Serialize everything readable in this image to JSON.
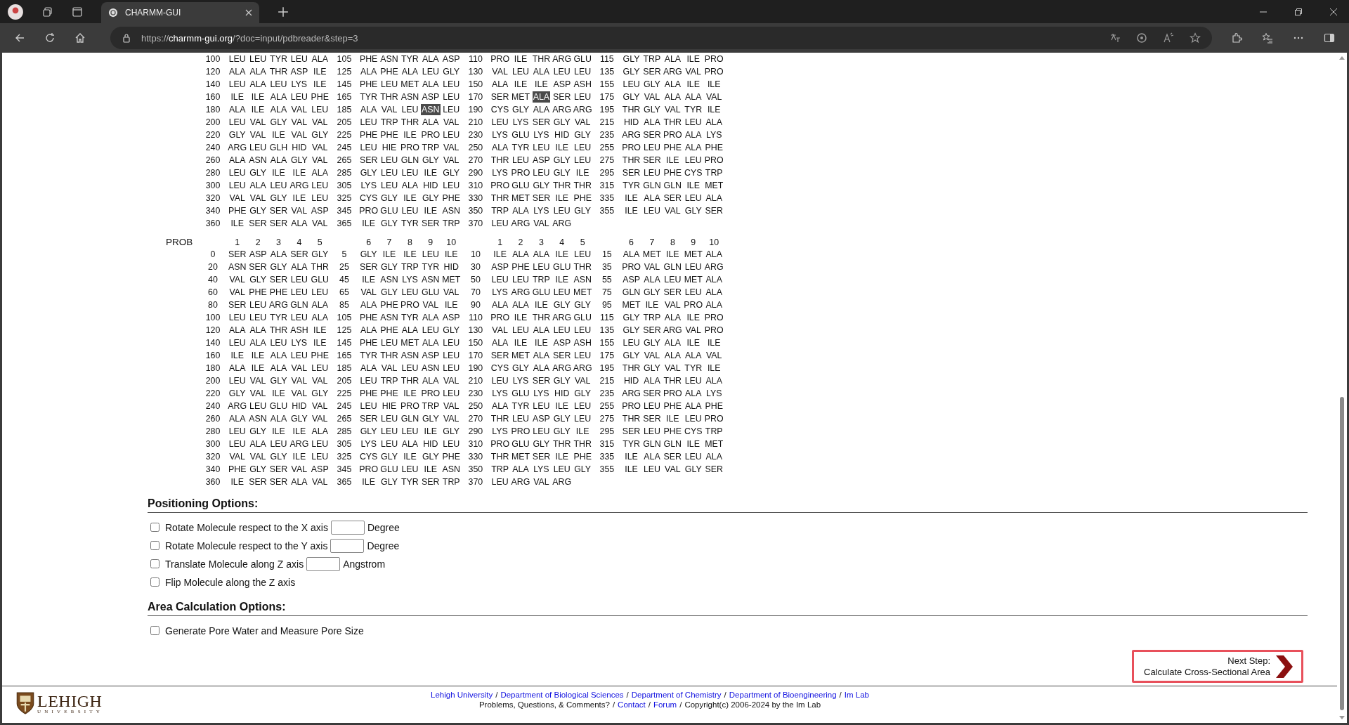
{
  "browser": {
    "tab_title": "CHARMM-GUI",
    "url": "https://**charmm-gui.org**/?doc=input/pdbreader&step=3"
  },
  "sequence_blocks": [
    {
      "rows": [
        [
          {
            "number": "100",
            "residues": [
              "LEU",
              "LEU",
              "TYR",
              "LEU",
              "ALA"
            ]
          },
          {
            "number": "105",
            "residues": [
              "PHE",
              "ASN",
              "TYR",
              "ALA",
              "ASP"
            ]
          },
          {
            "number": "110",
            "residues": [
              "PRO",
              "ILE",
              "THR",
              "ARG",
              "GLU"
            ]
          },
          {
            "number": "115",
            "residues": [
              "GLY",
              "TRP",
              "ALA",
              "ILE",
              "PRO"
            ]
          }
        ],
        [
          {
            "number": "120",
            "residues": [
              "ALA",
              "ALA",
              "THR",
              "ASP",
              "ILE"
            ]
          },
          {
            "number": "125",
            "residues": [
              "ALA",
              "PHE",
              "ALA",
              "LEU",
              "GLY"
            ]
          },
          {
            "number": "130",
            "residues": [
              "VAL",
              "LEU",
              "ALA",
              "LEU",
              "LEU"
            ]
          },
          {
            "number": "135",
            "residues": [
              "GLY",
              "SER",
              "ARG",
              "VAL",
              "PRO"
            ]
          }
        ],
        [
          {
            "number": "140",
            "residues": [
              "LEU",
              "ALA",
              "LEU",
              "LYS",
              "ILE"
            ]
          },
          {
            "number": "145",
            "residues": [
              "PHE",
              "LEU",
              "MET",
              "ALA",
              "LEU"
            ]
          },
          {
            "number": "150",
            "residues": [
              "ALA",
              "ILE",
              "ILE",
              "ASP",
              "ASH"
            ]
          },
          {
            "number": "155",
            "residues": [
              "LEU",
              "GLY",
              "ALA",
              "ILE",
              "ILE"
            ]
          }
        ],
        [
          {
            "number": "160",
            "residues": [
              "ILE",
              "ILE",
              "ALA",
              "LEU",
              "PHE"
            ]
          },
          {
            "number": "165",
            "residues": [
              "TYR",
              "THR",
              "ASN",
              "ASP",
              "LEU"
            ]
          },
          {
            "number": "170",
            "residues": [
              "SER",
              "MET",
              {
                "name": "ALA",
                "selected": true
              },
              "SER",
              "LEU"
            ]
          },
          {
            "number": "175",
            "residues": [
              "GLY",
              "VAL",
              "ALA",
              "ALA",
              "VAL"
            ]
          }
        ],
        [
          {
            "number": "180",
            "residues": [
              "ALA",
              "ILE",
              "ALA",
              "VAL",
              "LEU"
            ]
          },
          {
            "number": "185",
            "residues": [
              "ALA",
              "VAL",
              "LEU",
              {
                "name": "ASN",
                "selected": true
              },
              "LEU"
            ]
          },
          {
            "number": "190",
            "residues": [
              "CYS",
              "GLY",
              "ALA",
              "ARG",
              "ARG"
            ]
          },
          {
            "number": "195",
            "residues": [
              "THR",
              "GLY",
              "VAL",
              "TYR",
              "ILE"
            ]
          }
        ],
        [
          {
            "number": "200",
            "residues": [
              "LEU",
              "VAL",
              "GLY",
              "VAL",
              "VAL"
            ]
          },
          {
            "number": "205",
            "residues": [
              "LEU",
              "TRP",
              "THR",
              "ALA",
              "VAL"
            ]
          },
          {
            "number": "210",
            "residues": [
              "LEU",
              "LYS",
              "SER",
              "GLY",
              "VAL"
            ]
          },
          {
            "number": "215",
            "residues": [
              "HID",
              "ALA",
              "THR",
              "LEU",
              "ALA"
            ]
          }
        ],
        [
          {
            "number": "220",
            "residues": [
              "GLY",
              "VAL",
              "ILE",
              "VAL",
              "GLY"
            ]
          },
          {
            "number": "225",
            "residues": [
              "PHE",
              "PHE",
              "ILE",
              "PRO",
              "LEU"
            ]
          },
          {
            "number": "230",
            "residues": [
              "LYS",
              "GLU",
              "LYS",
              "HID",
              "GLY"
            ]
          },
          {
            "number": "235",
            "residues": [
              "ARG",
              "SER",
              "PRO",
              "ALA",
              "LYS"
            ]
          }
        ],
        [
          {
            "number": "240",
            "residues": [
              "ARG",
              "LEU",
              "GLH",
              "HID",
              "VAL"
            ]
          },
          {
            "number": "245",
            "residues": [
              "LEU",
              "HIE",
              "PRO",
              "TRP",
              "VAL"
            ]
          },
          {
            "number": "250",
            "residues": [
              "ALA",
              "TYR",
              "LEU",
              "ILE",
              "LEU"
            ]
          },
          {
            "number": "255",
            "residues": [
              "PRO",
              "LEU",
              "PHE",
              "ALA",
              "PHE"
            ]
          }
        ],
        [
          {
            "number": "260",
            "residues": [
              "ALA",
              "ASN",
              "ALA",
              "GLY",
              "VAL"
            ]
          },
          {
            "number": "265",
            "residues": [
              "SER",
              "LEU",
              "GLN",
              "GLY",
              "VAL"
            ]
          },
          {
            "number": "270",
            "residues": [
              "THR",
              "LEU",
              "ASP",
              "GLY",
              "LEU"
            ]
          },
          {
            "number": "275",
            "residues": [
              "THR",
              "SER",
              "ILE",
              "LEU",
              "PRO"
            ]
          }
        ],
        [
          {
            "number": "280",
            "residues": [
              "LEU",
              "GLY",
              "ILE",
              "ILE",
              "ALA"
            ]
          },
          {
            "number": "285",
            "residues": [
              "GLY",
              "LEU",
              "LEU",
              "ILE",
              "GLY"
            ]
          },
          {
            "number": "290",
            "residues": [
              "LYS",
              "PRO",
              "LEU",
              "GLY",
              "ILE"
            ]
          },
          {
            "number": "295",
            "residues": [
              "SER",
              "LEU",
              "PHE",
              "CYS",
              "TRP"
            ]
          }
        ],
        [
          {
            "number": "300",
            "residues": [
              "LEU",
              "ALA",
              "LEU",
              "ARG",
              "LEU"
            ]
          },
          {
            "number": "305",
            "residues": [
              "LYS",
              "LEU",
              "ALA",
              "HID",
              "LEU"
            ]
          },
          {
            "number": "310",
            "residues": [
              "PRO",
              "GLU",
              "GLY",
              "THR",
              "THR"
            ]
          },
          {
            "number": "315",
            "residues": [
              "TYR",
              "GLN",
              "GLN",
              "ILE",
              "MET"
            ]
          }
        ],
        [
          {
            "number": "320",
            "residues": [
              "VAL",
              "VAL",
              "GLY",
              "ILE",
              "LEU"
            ]
          },
          {
            "number": "325",
            "residues": [
              "CYS",
              "GLY",
              "ILE",
              "GLY",
              "PHE"
            ]
          },
          {
            "number": "330",
            "residues": [
              "THR",
              "MET",
              "SER",
              "ILE",
              "PHE"
            ]
          },
          {
            "number": "335",
            "residues": [
              "ILE",
              "ALA",
              "SER",
              "LEU",
              "ALA"
            ]
          }
        ],
        [
          {
            "number": "340",
            "residues": [
              "PHE",
              "GLY",
              "SER",
              "VAL",
              "ASP"
            ]
          },
          {
            "number": "345",
            "residues": [
              "PRO",
              "GLU",
              "LEU",
              "ILE",
              "ASN"
            ]
          },
          {
            "number": "350",
            "residues": [
              "TRP",
              "ALA",
              "LYS",
              "LEU",
              "GLY"
            ]
          },
          {
            "number": "355",
            "residues": [
              "ILE",
              "LEU",
              "VAL",
              "GLY",
              "SER"
            ]
          }
        ],
        [
          {
            "number": "360",
            "residues": [
              "ILE",
              "SER",
              "SER",
              "ALA",
              "VAL"
            ]
          },
          {
            "number": "365",
            "residues": [
              "ILE",
              "GLY",
              "TYR",
              "SER",
              "TRP"
            ]
          },
          {
            "number": "370",
            "residues": [
              "LEU",
              "ARG",
              "VAL",
              "ARG"
            ]
          }
        ]
      ]
    },
    {
      "label": "PROB",
      "column_numbers": [
        "1",
        "2",
        "3",
        "4",
        "5",
        "6",
        "7",
        "8",
        "9",
        "10",
        "1",
        "2",
        "3",
        "4",
        "5",
        "6",
        "7",
        "8",
        "9",
        "10"
      ],
      "rows": [
        [
          {
            "number": "0",
            "residues": [
              "SER",
              "ASP",
              "ALA",
              "SER",
              "GLY"
            ]
          },
          {
            "number": "5",
            "residues": [
              "GLY",
              "ILE",
              "ILE",
              "LEU",
              "ILE"
            ]
          },
          {
            "number": "10",
            "residues": [
              "ILE",
              "ALA",
              "ALA",
              "ILE",
              "LEU"
            ]
          },
          {
            "number": "15",
            "residues": [
              "ALA",
              "MET",
              "ILE",
              "MET",
              "ALA"
            ]
          }
        ],
        [
          {
            "number": "20",
            "residues": [
              "ASN",
              "SER",
              "GLY",
              "ALA",
              "THR"
            ]
          },
          {
            "number": "25",
            "residues": [
              "SER",
              "GLY",
              "TRP",
              "TYR",
              "HID"
            ]
          },
          {
            "number": "30",
            "residues": [
              "ASP",
              "PHE",
              "LEU",
              "GLU",
              "THR"
            ]
          },
          {
            "number": "35",
            "residues": [
              "PRO",
              "VAL",
              "GLN",
              "LEU",
              "ARG"
            ]
          }
        ],
        [
          {
            "number": "40",
            "residues": [
              "VAL",
              "GLY",
              "SER",
              "LEU",
              "GLU"
            ]
          },
          {
            "number": "45",
            "residues": [
              "ILE",
              "ASN",
              "LYS",
              "ASN",
              "MET"
            ]
          },
          {
            "number": "50",
            "residues": [
              "LEU",
              "LEU",
              "TRP",
              "ILE",
              "ASN"
            ]
          },
          {
            "number": "55",
            "residues": [
              "ASP",
              "ALA",
              "LEU",
              "MET",
              "ALA"
            ]
          }
        ],
        [
          {
            "number": "60",
            "residues": [
              "VAL",
              "PHE",
              "PHE",
              "LEU",
              "LEU"
            ]
          },
          {
            "number": "65",
            "residues": [
              "VAL",
              "GLY",
              "LEU",
              "GLU",
              "VAL"
            ]
          },
          {
            "number": "70",
            "residues": [
              "LYS",
              "ARG",
              "GLU",
              "LEU",
              "MET"
            ]
          },
          {
            "number": "75",
            "residues": [
              "GLN",
              "GLY",
              "SER",
              "LEU",
              "ALA"
            ]
          }
        ],
        [
          {
            "number": "80",
            "residues": [
              "SER",
              "LEU",
              "ARG",
              "GLN",
              "ALA"
            ]
          },
          {
            "number": "85",
            "residues": [
              "ALA",
              "PHE",
              "PRO",
              "VAL",
              "ILE"
            ]
          },
          {
            "number": "90",
            "residues": [
              "ALA",
              "ALA",
              "ILE",
              "GLY",
              "GLY"
            ]
          },
          {
            "number": "95",
            "residues": [
              "MET",
              "ILE",
              "VAL",
              "PRO",
              "ALA"
            ]
          }
        ],
        [
          {
            "number": "100",
            "residues": [
              "LEU",
              "LEU",
              "TYR",
              "LEU",
              "ALA"
            ]
          },
          {
            "number": "105",
            "residues": [
              "PHE",
              "ASN",
              "TYR",
              "ALA",
              "ASP"
            ]
          },
          {
            "number": "110",
            "residues": [
              "PRO",
              "ILE",
              "THR",
              "ARG",
              "GLU"
            ]
          },
          {
            "number": "115",
            "residues": [
              "GLY",
              "TRP",
              "ALA",
              "ILE",
              "PRO"
            ]
          }
        ],
        [
          {
            "number": "120",
            "residues": [
              "ALA",
              "ALA",
              "THR",
              "ASH",
              "ILE"
            ]
          },
          {
            "number": "125",
            "residues": [
              "ALA",
              "PHE",
              "ALA",
              "LEU",
              "GLY"
            ]
          },
          {
            "number": "130",
            "residues": [
              "VAL",
              "LEU",
              "ALA",
              "LEU",
              "LEU"
            ]
          },
          {
            "number": "135",
            "residues": [
              "GLY",
              "SER",
              "ARG",
              "VAL",
              "PRO"
            ]
          }
        ],
        [
          {
            "number": "140",
            "residues": [
              "LEU",
              "ALA",
              "LEU",
              "LYS",
              "ILE"
            ]
          },
          {
            "number": "145",
            "residues": [
              "PHE",
              "LEU",
              "MET",
              "ALA",
              "LEU"
            ]
          },
          {
            "number": "150",
            "residues": [
              "ALA",
              "ILE",
              "ILE",
              "ASP",
              "ASH"
            ]
          },
          {
            "number": "155",
            "residues": [
              "LEU",
              "GLY",
              "ALA",
              "ILE",
              "ILE"
            ]
          }
        ],
        [
          {
            "number": "160",
            "residues": [
              "ILE",
              "ILE",
              "ALA",
              "LEU",
              "PHE"
            ]
          },
          {
            "number": "165",
            "residues": [
              "TYR",
              "THR",
              "ASN",
              "ASP",
              "LEU"
            ]
          },
          {
            "number": "170",
            "residues": [
              "SER",
              "MET",
              "ALA",
              "SER",
              "LEU"
            ]
          },
          {
            "number": "175",
            "residues": [
              "GLY",
              "VAL",
              "ALA",
              "ALA",
              "VAL"
            ]
          }
        ],
        [
          {
            "number": "180",
            "residues": [
              "ALA",
              "ILE",
              "ALA",
              "VAL",
              "LEU"
            ]
          },
          {
            "number": "185",
            "residues": [
              "ALA",
              "VAL",
              "LEU",
              "ASN",
              "LEU"
            ]
          },
          {
            "number": "190",
            "residues": [
              "CYS",
              "GLY",
              "ALA",
              "ARG",
              "ARG"
            ]
          },
          {
            "number": "195",
            "residues": [
              "THR",
              "GLY",
              "VAL",
              "TYR",
              "ILE"
            ]
          }
        ],
        [
          {
            "number": "200",
            "residues": [
              "LEU",
              "VAL",
              "GLY",
              "VAL",
              "VAL"
            ]
          },
          {
            "number": "205",
            "residues": [
              "LEU",
              "TRP",
              "THR",
              "ALA",
              "VAL"
            ]
          },
          {
            "number": "210",
            "residues": [
              "LEU",
              "LYS",
              "SER",
              "GLY",
              "VAL"
            ]
          },
          {
            "number": "215",
            "residues": [
              "HID",
              "ALA",
              "THR",
              "LEU",
              "ALA"
            ]
          }
        ],
        [
          {
            "number": "220",
            "residues": [
              "GLY",
              "VAL",
              "ILE",
              "VAL",
              "GLY"
            ]
          },
          {
            "number": "225",
            "residues": [
              "PHE",
              "PHE",
              "ILE",
              "PRO",
              "LEU"
            ]
          },
          {
            "number": "230",
            "residues": [
              "LYS",
              "GLU",
              "LYS",
              "HID",
              "GLY"
            ]
          },
          {
            "number": "235",
            "residues": [
              "ARG",
              "SER",
              "PRO",
              "ALA",
              "LYS"
            ]
          }
        ],
        [
          {
            "number": "240",
            "residues": [
              "ARG",
              "LEU",
              "GLU",
              "HID",
              "VAL"
            ]
          },
          {
            "number": "245",
            "residues": [
              "LEU",
              "HIE",
              "PRO",
              "TRP",
              "VAL"
            ]
          },
          {
            "number": "250",
            "residues": [
              "ALA",
              "TYR",
              "LEU",
              "ILE",
              "LEU"
            ]
          },
          {
            "number": "255",
            "residues": [
              "PRO",
              "LEU",
              "PHE",
              "ALA",
              "PHE"
            ]
          }
        ],
        [
          {
            "number": "260",
            "residues": [
              "ALA",
              "ASN",
              "ALA",
              "GLY",
              "VAL"
            ]
          },
          {
            "number": "265",
            "residues": [
              "SER",
              "LEU",
              "GLN",
              "GLY",
              "VAL"
            ]
          },
          {
            "number": "270",
            "residues": [
              "THR",
              "LEU",
              "ASP",
              "GLY",
              "LEU"
            ]
          },
          {
            "number": "275",
            "residues": [
              "THR",
              "SER",
              "ILE",
              "LEU",
              "PRO"
            ]
          }
        ],
        [
          {
            "number": "280",
            "residues": [
              "LEU",
              "GLY",
              "ILE",
              "ILE",
              "ALA"
            ]
          },
          {
            "number": "285",
            "residues": [
              "GLY",
              "LEU",
              "LEU",
              "ILE",
              "GLY"
            ]
          },
          {
            "number": "290",
            "residues": [
              "LYS",
              "PRO",
              "LEU",
              "GLY",
              "ILE"
            ]
          },
          {
            "number": "295",
            "residues": [
              "SER",
              "LEU",
              "PHE",
              "CYS",
              "TRP"
            ]
          }
        ],
        [
          {
            "number": "300",
            "residues": [
              "LEU",
              "ALA",
              "LEU",
              "ARG",
              "LEU"
            ]
          },
          {
            "number": "305",
            "residues": [
              "LYS",
              "LEU",
              "ALA",
              "HID",
              "LEU"
            ]
          },
          {
            "number": "310",
            "residues": [
              "PRO",
              "GLU",
              "GLY",
              "THR",
              "THR"
            ]
          },
          {
            "number": "315",
            "residues": [
              "TYR",
              "GLN",
              "GLN",
              "ILE",
              "MET"
            ]
          }
        ],
        [
          {
            "number": "320",
            "residues": [
              "VAL",
              "VAL",
              "GLY",
              "ILE",
              "LEU"
            ]
          },
          {
            "number": "325",
            "residues": [
              "CYS",
              "GLY",
              "ILE",
              "GLY",
              "PHE"
            ]
          },
          {
            "number": "330",
            "residues": [
              "THR",
              "MET",
              "SER",
              "ILE",
              "PHE"
            ]
          },
          {
            "number": "335",
            "residues": [
              "ILE",
              "ALA",
              "SER",
              "LEU",
              "ALA"
            ]
          }
        ],
        [
          {
            "number": "340",
            "residues": [
              "PHE",
              "GLY",
              "SER",
              "VAL",
              "ASP"
            ]
          },
          {
            "number": "345",
            "residues": [
              "PRO",
              "GLU",
              "LEU",
              "ILE",
              "ASN"
            ]
          },
          {
            "number": "350",
            "residues": [
              "TRP",
              "ALA",
              "LYS",
              "LEU",
              "GLY"
            ]
          },
          {
            "number": "355",
            "residues": [
              "ILE",
              "LEU",
              "VAL",
              "GLY",
              "SER"
            ]
          }
        ],
        [
          {
            "number": "360",
            "residues": [
              "ILE",
              "SER",
              "SER",
              "ALA",
              "VAL"
            ]
          },
          {
            "number": "365",
            "residues": [
              "ILE",
              "GLY",
              "TYR",
              "SER",
              "TRP"
            ]
          },
          {
            "number": "370",
            "residues": [
              "LEU",
              "ARG",
              "VAL",
              "ARG"
            ]
          }
        ]
      ]
    }
  ],
  "sections": [
    {
      "title": "Positioning Options:",
      "options": [
        {
          "kind": "input",
          "label": "Rotate Molecule respect to the X axis",
          "unit": "Degree",
          "checked": false
        },
        {
          "kind": "input",
          "label": "Rotate Molecule respect to the Y axis",
          "unit": "Degree",
          "checked": false
        },
        {
          "kind": "input",
          "label": "Translate Molecule along Z axis",
          "unit": "Angstrom",
          "checked": false
        },
        {
          "kind": "plain",
          "label": "Flip Molecule along the Z axis",
          "checked": false
        }
      ]
    },
    {
      "title": "Area Calculation Options:",
      "options": [
        {
          "kind": "plain",
          "label": "Generate Pore Water and Measure Pore Size",
          "checked": false
        }
      ]
    }
  ],
  "next_step": {
    "caption": "Next Step:",
    "action": "Calculate Cross-Sectional Area",
    "highlighted": true
  },
  "footer": {
    "logo": {
      "name": "LEHIGH",
      "subtitle": "UNIVERSITY"
    },
    "separator": "/",
    "links": [
      "Lehigh University",
      "Department of Biological Sciences",
      "Department of Chemistry",
      "Department of Bioengineering",
      "Im Lab"
    ],
    "question": "Problems, Questions, & Comments?",
    "contact_links": [
      "Contact",
      "Forum"
    ],
    "copyright": "Copyright(c) 2006-2024 by the Im Lab"
  }
}
